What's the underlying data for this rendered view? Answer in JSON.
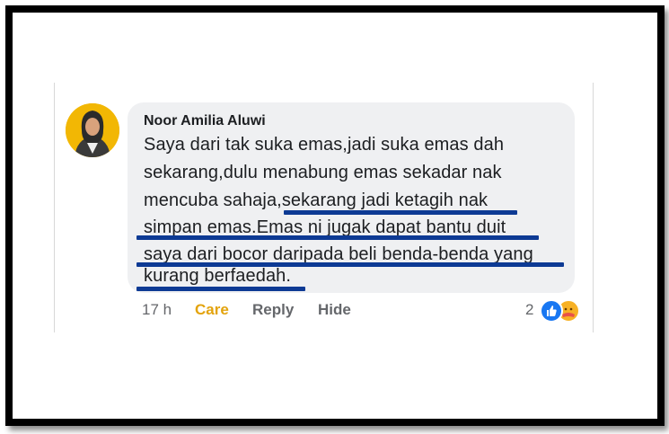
{
  "comment": {
    "author": "Noor Amilia Aluwi",
    "lines": [
      "Saya dari tak suka emas,jadi suka emas dah",
      "sekarang,dulu menabung emas sekadar nak",
      "mencuba sahaja,sekarang jadi ketagih nak",
      "simpan emas.Emas ni jugak dapat bantu duit",
      "saya dari bocor daripada beli benda-benda yang",
      "kurang berfaedah."
    ]
  },
  "actions": {
    "time": "17 h",
    "care_label": "Care",
    "reply_label": "Reply",
    "hide_label": "Hide",
    "reaction_count": "2"
  },
  "reactions": {
    "icons": [
      "like-icon",
      "care-reaction-icon"
    ]
  },
  "colors": {
    "underline": "#0d3a94",
    "care": "#e3a30c",
    "like": "#1877f2",
    "bubble": "#eff0f2"
  }
}
